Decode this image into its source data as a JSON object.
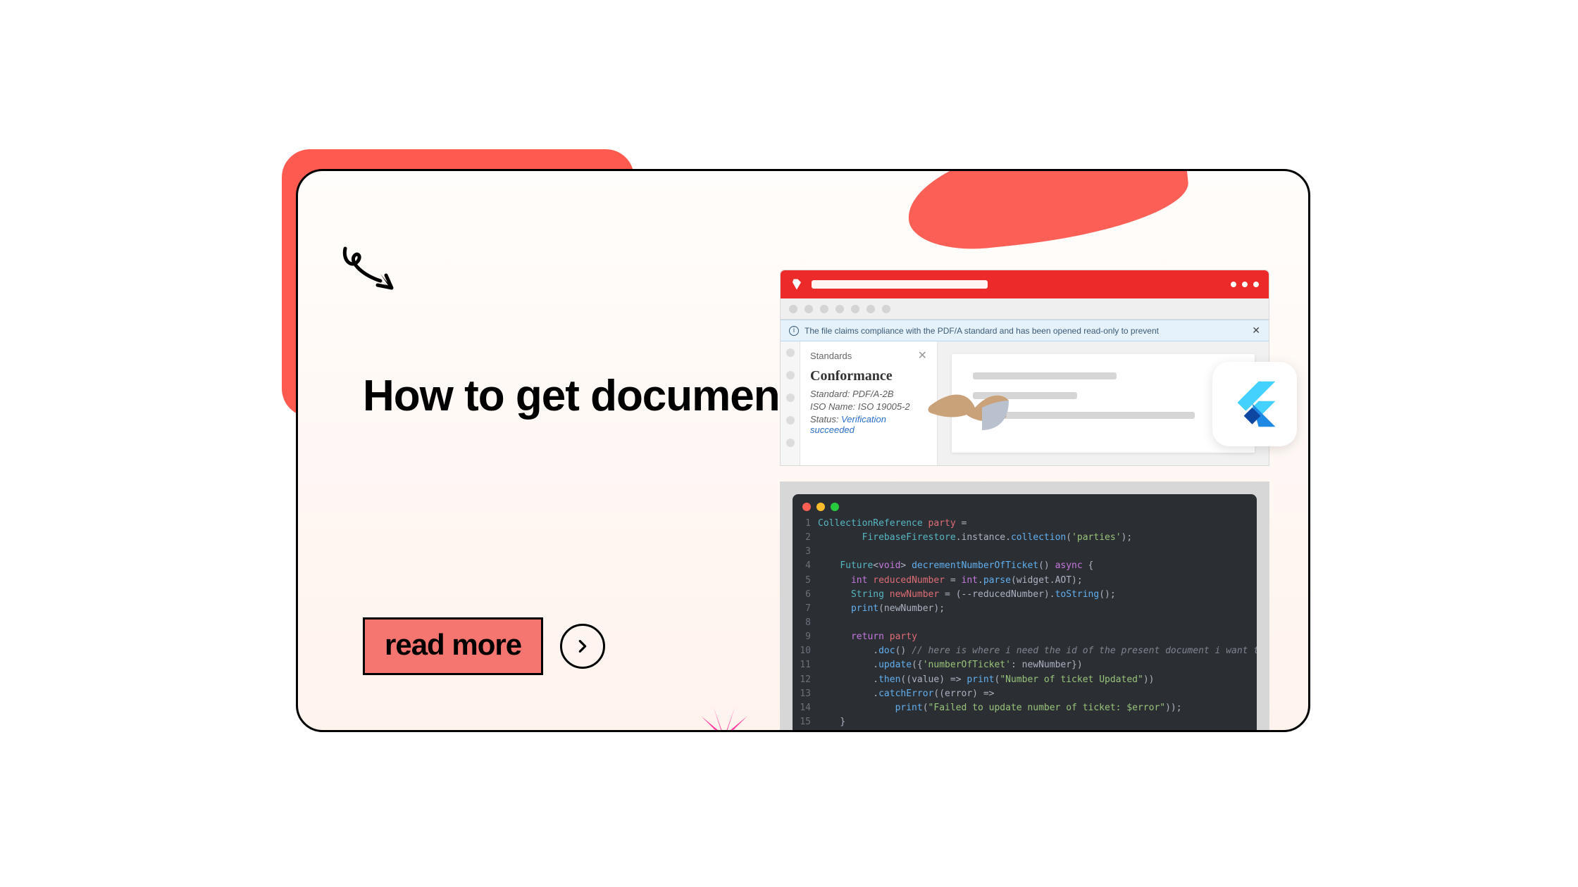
{
  "title": "How to get document id in firestore flutter",
  "cta_label": "read more",
  "pdf": {
    "banner_text": "The file claims compliance with the PDF/A standard and has been opened read-only to prevent",
    "panel_title": "Standards",
    "conformance_heading": "Conformance",
    "standard_label": "Standard:",
    "standard_value": "PDF/A-2B",
    "iso_label": "ISO Name:",
    "iso_value": "ISO 19005-2",
    "status_label": "Status:",
    "status_value": "Verification succeeded"
  },
  "code": {
    "lines": [
      {
        "n": "1",
        "html": "<span class=\"tk-type\">CollectionReference</span> <span class=\"tk-var\">party</span> <span class=\"tk-pl\">=</span>"
      },
      {
        "n": "2",
        "html": "        <span class=\"tk-type\">FirebaseFirestore</span><span class=\"tk-pl\">.instance.</span><span class=\"tk-fn\">collection</span><span class=\"tk-pl\">(</span><span class=\"tk-str\">'parties'</span><span class=\"tk-pl\">);</span>"
      },
      {
        "n": "3",
        "html": ""
      },
      {
        "n": "4",
        "html": "    <span class=\"tk-type\">Future</span><span class=\"tk-pl\">&lt;</span><span class=\"tk-kw\">void</span><span class=\"tk-pl\">&gt; </span><span class=\"tk-fn\">decrementNumberOfTicket</span><span class=\"tk-pl\">() </span><span class=\"tk-kw\">async</span><span class=\"tk-pl\"> {</span>"
      },
      {
        "n": "5",
        "html": "      <span class=\"tk-kw\">int</span> <span class=\"tk-var\">reducedNumber</span> <span class=\"tk-pl\">= </span><span class=\"tk-kw\">int</span><span class=\"tk-pl\">.</span><span class=\"tk-fn\">parse</span><span class=\"tk-pl\">(widget.AOT);</span>"
      },
      {
        "n": "6",
        "html": "      <span class=\"tk-type\">String</span> <span class=\"tk-var\">newNumber</span> <span class=\"tk-pl\">= (--reducedNumber).</span><span class=\"tk-fn\">toString</span><span class=\"tk-pl\">();</span>"
      },
      {
        "n": "7",
        "html": "      <span class=\"tk-fn\">print</span><span class=\"tk-pl\">(newNumber);</span>"
      },
      {
        "n": "8",
        "html": ""
      },
      {
        "n": "9",
        "html": "      <span class=\"tk-kw\">return</span> <span class=\"tk-var\">party</span>"
      },
      {
        "n": "10",
        "html": "          <span class=\"tk-pl\">.</span><span class=\"tk-fn\">doc</span><span class=\"tk-pl\">() </span><span class=\"tk-cm\">// here is where i need the id of the present document i want to edit</span>"
      },
      {
        "n": "11",
        "html": "          <span class=\"tk-pl\">.</span><span class=\"tk-fn\">update</span><span class=\"tk-pl\">({</span><span class=\"tk-str\">'numberOfTicket'</span><span class=\"tk-pl\">: newNumber})</span>"
      },
      {
        "n": "12",
        "html": "          <span class=\"tk-pl\">.</span><span class=\"tk-fn\">then</span><span class=\"tk-pl\">((value) =&gt; </span><span class=\"tk-fn\">print</span><span class=\"tk-pl\">(</span><span class=\"tk-str\">\"Number of ticket Updated\"</span><span class=\"tk-pl\">))</span>"
      },
      {
        "n": "13",
        "html": "          <span class=\"tk-pl\">.</span><span class=\"tk-fn\">catchError</span><span class=\"tk-pl\">((error) =&gt;</span>"
      },
      {
        "n": "14",
        "html": "              <span class=\"tk-fn\">print</span><span class=\"tk-pl\">(</span><span class=\"tk-str\">\"Failed to update number of ticket: $error\"</span><span class=\"tk-pl\">));</span>"
      },
      {
        "n": "15",
        "html": "    <span class=\"tk-pl\">}</span>"
      }
    ]
  }
}
